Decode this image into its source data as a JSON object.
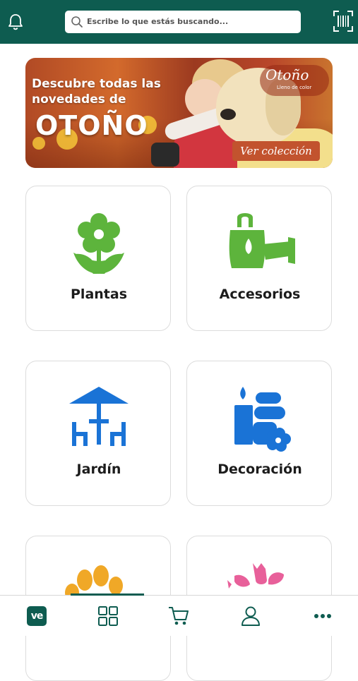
{
  "header": {
    "search_placeholder": "Escribe lo que estás buscando...",
    "icons": [
      "bell-icon",
      "search-icon",
      "barcode-scan-icon"
    ],
    "background": "#0e5c50"
  },
  "banner": {
    "headline": "Descubre todas las novedades de",
    "highlight": "OTOÑO",
    "badge_title": "Otoño",
    "badge_subtitle": "Lleno de color",
    "cta": "Ver colección"
  },
  "categories": [
    {
      "label": "Plantas",
      "icon": "flower-icon",
      "color": "#5db43c"
    },
    {
      "label": "Accesorios",
      "icon": "watering-can-icon",
      "color": "#5db43c"
    },
    {
      "label": "Jardín",
      "icon": "garden-table-umbrella-icon",
      "color": "#1a73d6"
    },
    {
      "label": "Decoración",
      "icon": "candle-stones-icon",
      "color": "#1a73d6"
    },
    {
      "label": "",
      "icon": "paw-icon",
      "color": "#f0a827"
    },
    {
      "label": "",
      "icon": "tulips-icon",
      "color": "#e8609a"
    }
  ],
  "bottom_nav": {
    "logo": "ve",
    "items": [
      "home-logo",
      "categories-grid-icon",
      "cart-icon",
      "user-icon",
      "more-icon"
    ],
    "active_index": 1
  }
}
